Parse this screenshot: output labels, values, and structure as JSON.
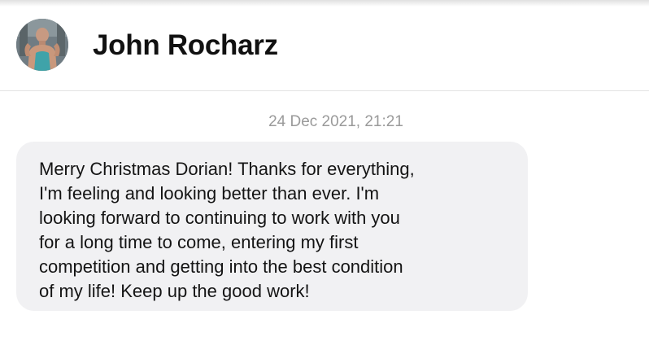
{
  "conversation": {
    "contact_name": "John Rocharz",
    "avatar_icon": "person-photo-icon"
  },
  "messages": [
    {
      "timestamp": "24 Dec 2021, 21:21",
      "text": "Merry Christmas Dorian! Thanks for everything,\nI'm feeling and looking better than ever. I'm\nlooking forward to continuing to work with you\nfor a long time to come, entering my first\ncompetition and getting into the best condition\nof my life! Keep up the good work!"
    }
  ],
  "colors": {
    "bubble_background": "#f1f1f3",
    "timestamp_text": "#9a9a9a",
    "name_text": "#111111"
  }
}
